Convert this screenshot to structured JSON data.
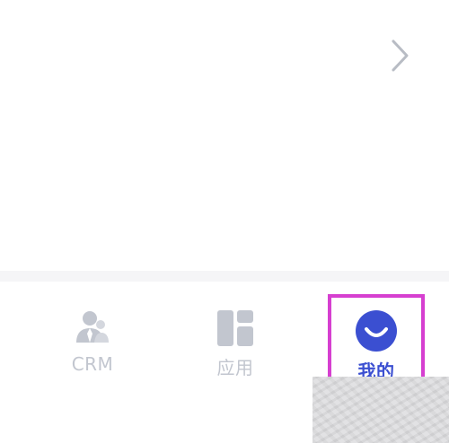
{
  "colors": {
    "accent": "#3b4fd1",
    "inactive": "#c2c6cf",
    "highlight_border": "#d63fd0",
    "separator": "#f5f5f7"
  },
  "header": {
    "chevron_icon": "chevron-right-icon"
  },
  "tabbar": {
    "items": [
      {
        "label": "CRM",
        "icon": "crm-people-icon",
        "active": false
      },
      {
        "label": "应用",
        "icon": "apps-grid-icon",
        "active": false
      },
      {
        "label": "我的",
        "icon": "smiley-profile-icon",
        "active": true
      }
    ]
  }
}
